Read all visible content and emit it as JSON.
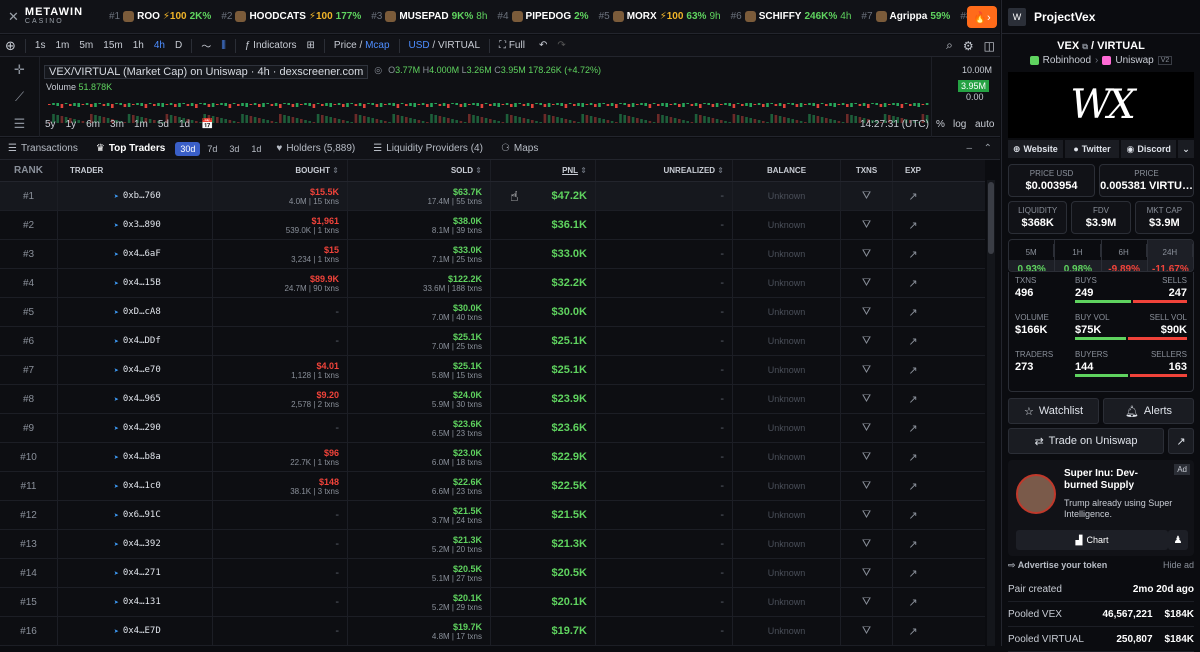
{
  "brand": {
    "name": "METAWIN",
    "sub": "CASINO",
    "mark": "✕"
  },
  "trending": [
    {
      "rank": "#1",
      "symbol": "ROO",
      "boost": "⚡100",
      "change": "2K%",
      "age": ""
    },
    {
      "rank": "#2",
      "symbol": "HOODCATS",
      "boost": "⚡100",
      "change": "177%",
      "age": ""
    },
    {
      "rank": "#3",
      "symbol": "MUSEPAD",
      "boost": "",
      "change": "9K%",
      "age": "8h"
    },
    {
      "rank": "#4",
      "symbol": "PIPEDOG",
      "boost": "",
      "change": "2%",
      "age": ""
    },
    {
      "rank": "#5",
      "symbol": "MORX",
      "boost": "⚡100",
      "change": "63%",
      "age": "9h"
    },
    {
      "rank": "#6",
      "symbol": "SCHIFFY",
      "boost": "",
      "change": "246K%",
      "age": "4h"
    },
    {
      "rank": "#7",
      "symbol": "Agrippa",
      "boost": "",
      "change": "59%",
      "age": ""
    },
    {
      "rank": "#8",
      "symbol": "",
      "boost": "",
      "change": "",
      "age": ""
    }
  ],
  "toolbar": {
    "intervals": [
      "1s",
      "1m",
      "5m",
      "15m",
      "1h",
      "4h",
      "D"
    ],
    "active_interval": "4h",
    "indicators": "Indicators",
    "price": "Price",
    "mcap": "Mcap",
    "usd": "USD",
    "virtual": "VIRTUAL",
    "full": "Full"
  },
  "chart": {
    "pair": "VEX/VIRTUAL (Market Cap) on Uniswap · 4h · dexscreener.com",
    "ohlc": {
      "o": "3.77M",
      "h": "4.000M",
      "l": "3.26M",
      "c": "3.95M",
      "chg": "178.26K (+4.72%)"
    },
    "volume_label": "Volume",
    "volume_value": "51.878K",
    "axis_top": "10.00M",
    "price_badge": "3.95M",
    "axis_bottom": "0.00",
    "ranges": [
      "5y",
      "1y",
      "6m",
      "3m",
      "1m",
      "5d",
      "1d"
    ],
    "time": "14:27:31 (UTC)",
    "pct": "%",
    "log": "log",
    "auto": "auto"
  },
  "tabs": {
    "transactions": "Transactions",
    "top_traders": "Top Traders",
    "periods": [
      "30d",
      "7d",
      "3d",
      "1d"
    ],
    "holders": "Holders (5,889)",
    "lp": "Liquidity Providers (4)",
    "maps": "Maps"
  },
  "columns": {
    "rank": "RANK",
    "trader": "TRADER",
    "bought": "BOUGHT",
    "sold": "SOLD",
    "pnl": "PNL",
    "unrealized": "UNREALIZED",
    "balance": "BALANCE",
    "txns": "TXNS",
    "exp": "EXP"
  },
  "rows": [
    {
      "rank": "#1",
      "trader": "0xb…760",
      "bought": "$15.5K",
      "bought_sub": "4.0M | 15 txns",
      "sold": "$63.7K",
      "sold_sub": "17.4M | 55 txns",
      "pnl": "$47.2K",
      "unrealized": "-",
      "balance": "Unknown"
    },
    {
      "rank": "#2",
      "trader": "0x3…890",
      "bought": "$1,961",
      "bought_sub": "539.0K | 1 txns",
      "sold": "$38.0K",
      "sold_sub": "8.1M | 39 txns",
      "pnl": "$36.1K",
      "unrealized": "-",
      "balance": "Unknown"
    },
    {
      "rank": "#3",
      "trader": "0x4…6aF",
      "bought": "$15",
      "bought_sub": "3,234 | 1 txns",
      "sold": "$33.0K",
      "sold_sub": "7.1M | 25 txns",
      "pnl": "$33.0K",
      "unrealized": "-",
      "balance": "Unknown"
    },
    {
      "rank": "#4",
      "trader": "0x4…15B",
      "bought": "$89.9K",
      "bought_sub": "24.7M | 90 txns",
      "sold": "$122.2K",
      "sold_sub": "33.6M | 188 txns",
      "pnl": "$32.2K",
      "unrealized": "-",
      "balance": "Unknown"
    },
    {
      "rank": "#5",
      "trader": "0xD…cA8",
      "bought": "",
      "bought_sub": "",
      "sold": "$30.0K",
      "sold_sub": "7.0M | 40 txns",
      "pnl": "$30.0K",
      "unrealized": "-",
      "balance": "Unknown"
    },
    {
      "rank": "#6",
      "trader": "0x4…DDf",
      "bought": "",
      "bought_sub": "",
      "sold": "$25.1K",
      "sold_sub": "7.0M | 25 txns",
      "pnl": "$25.1K",
      "unrealized": "-",
      "balance": "Unknown"
    },
    {
      "rank": "#7",
      "trader": "0x4…e70",
      "bought": "$4.01",
      "bought_sub": "1,128 | 1 txns",
      "sold": "$25.1K",
      "sold_sub": "5.8M | 15 txns",
      "pnl": "$25.1K",
      "unrealized": "-",
      "balance": "Unknown"
    },
    {
      "rank": "#8",
      "trader": "0x4…965",
      "bought": "$9.20",
      "bought_sub": "2,578 | 2 txns",
      "sold": "$24.0K",
      "sold_sub": "5.9M | 30 txns",
      "pnl": "$23.9K",
      "unrealized": "-",
      "balance": "Unknown"
    },
    {
      "rank": "#9",
      "trader": "0x4…290",
      "bought": "",
      "bought_sub": "",
      "sold": "$23.6K",
      "sold_sub": "6.5M | 23 txns",
      "pnl": "$23.6K",
      "unrealized": "-",
      "balance": "Unknown"
    },
    {
      "rank": "#10",
      "trader": "0x4…b8a",
      "bought": "$96",
      "bought_sub": "22.7K | 1 txns",
      "sold": "$23.0K",
      "sold_sub": "6.0M | 18 txns",
      "pnl": "$22.9K",
      "unrealized": "-",
      "balance": "Unknown"
    },
    {
      "rank": "#11",
      "trader": "0x4…1c0",
      "bought": "$148",
      "bought_sub": "38.1K | 3 txns",
      "sold": "$22.6K",
      "sold_sub": "6.6M | 23 txns",
      "pnl": "$22.5K",
      "unrealized": "-",
      "balance": "Unknown"
    },
    {
      "rank": "#12",
      "trader": "0x6…91C",
      "bought": "",
      "bought_sub": "",
      "sold": "$21.5K",
      "sold_sub": "3.7M | 24 txns",
      "pnl": "$21.5K",
      "unrealized": "-",
      "balance": "Unknown"
    },
    {
      "rank": "#13",
      "trader": "0x4…392",
      "bought": "",
      "bought_sub": "",
      "sold": "$21.3K",
      "sold_sub": "5.2M | 20 txns",
      "pnl": "$21.3K",
      "unrealized": "-",
      "balance": "Unknown"
    },
    {
      "rank": "#14",
      "trader": "0x4…271",
      "bought": "",
      "bought_sub": "",
      "sold": "$20.5K",
      "sold_sub": "5.1M | 27 txns",
      "pnl": "$20.5K",
      "unrealized": "-",
      "balance": "Unknown"
    },
    {
      "rank": "#15",
      "trader": "0x4…131",
      "bought": "",
      "bought_sub": "",
      "sold": "$20.1K",
      "sold_sub": "5.2M | 29 txns",
      "pnl": "$20.1K",
      "unrealized": "-",
      "balance": "Unknown"
    },
    {
      "rank": "#16",
      "trader": "0x4…E7D",
      "bought": "",
      "bought_sub": "",
      "sold": "$19.7K",
      "sold_sub": "4.8M | 17 txns",
      "pnl": "$19.7K",
      "unrealized": "-",
      "balance": "Unknown"
    }
  ],
  "empty_cell": "-",
  "panel": {
    "name": "ProjectVex",
    "logo": "W",
    "pair_base": "VEX",
    "pair_quote": "/ VIRTUAL",
    "chain": "Robinhood",
    "dex": "Uniswap",
    "version": "V2",
    "banner_text": "WX",
    "links": {
      "website": "Website",
      "twitter": "Twitter",
      "discord": "Discord"
    },
    "price_usd_label": "PRICE USD",
    "price_usd": "$0.003954",
    "price_label": "PRICE",
    "price": "0.005381 VIRTU…",
    "liquidity_label": "LIQUIDITY",
    "liquidity": "$368K",
    "fdv_label": "FDV",
    "fdv": "$3.9M",
    "mktcap_label": "MKT CAP",
    "mktcap": "$3.9M",
    "changes": [
      {
        "label": "5M",
        "value": "0.93%",
        "sign": "p"
      },
      {
        "label": "1H",
        "value": "0.98%",
        "sign": "p"
      },
      {
        "label": "6H",
        "value": "-9.89%",
        "sign": "n"
      },
      {
        "label": "24H",
        "value": "-11.67%",
        "sign": "n"
      }
    ],
    "txns_label": "TXNS",
    "txns": "496",
    "buys_label": "BUYS",
    "buys": "249",
    "sells_label": "SELLS",
    "sells": "247",
    "volume_label": "VOLUME",
    "volume": "$166K",
    "buyvol_label": "BUY VOL",
    "buyvol": "$75K",
    "sellvol_label": "SELL VOL",
    "sellvol": "$90K",
    "traders_label": "TRADERS",
    "traders": "273",
    "buyers_label": "BUYERS",
    "buyers": "144",
    "sellers_label": "SELLERS",
    "sellers": "163",
    "buys_fraction": 0.502,
    "buyvol_fraction": 0.455,
    "buyers_fraction": 0.469,
    "watchlist": "Watchlist",
    "alerts": "Alerts",
    "trade": "Trade on Uniswap",
    "ad_title": "Super Inu: Dev-burned Supply",
    "ad_desc": "Trump already using Super Intelligence.",
    "ad_label": "Ad",
    "ad_chart": "Chart",
    "advertise": "Advertise your token",
    "hide_ad": "Hide ad",
    "pair_created_label": "Pair created",
    "pair_created": "2mo 20d ago",
    "pooled_vex_label": "Pooled VEX",
    "pooled_vex": "46,567,221",
    "pooled_vex_usd": "$184K",
    "pooled_virtual_label": "Pooled VIRTUAL",
    "pooled_virtual": "250,807",
    "pooled_virtual_usd": "$184K"
  }
}
